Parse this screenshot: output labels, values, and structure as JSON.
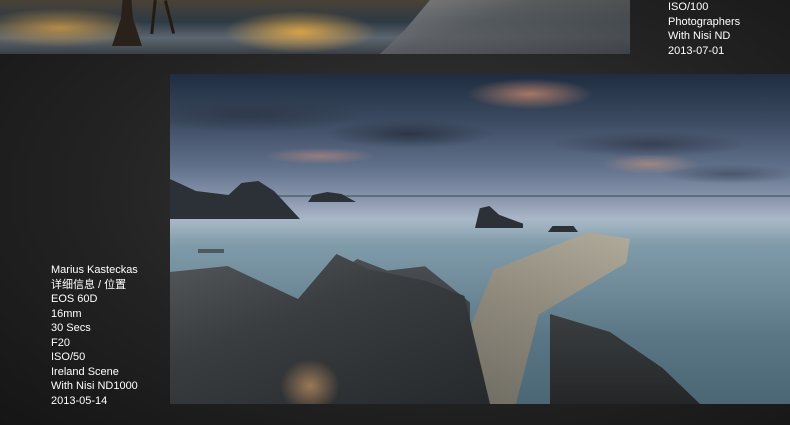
{
  "top_photo": {
    "caption_lines": [
      "ISO/100",
      "Photographers",
      "With Nisi ND",
      "2013-07-01"
    ]
  },
  "main_photo": {
    "caption_lines": [
      "Marius Kasteckas",
      "详细信息 / 位置",
      "EOS 60D",
      "16mm",
      "30 Secs",
      "F20",
      "ISO/50",
      "Ireland Scene",
      "With Nisi ND1000",
      "2013-05-14"
    ]
  },
  "colors": {
    "background": "#232323",
    "caption_text": "#ffffff"
  }
}
